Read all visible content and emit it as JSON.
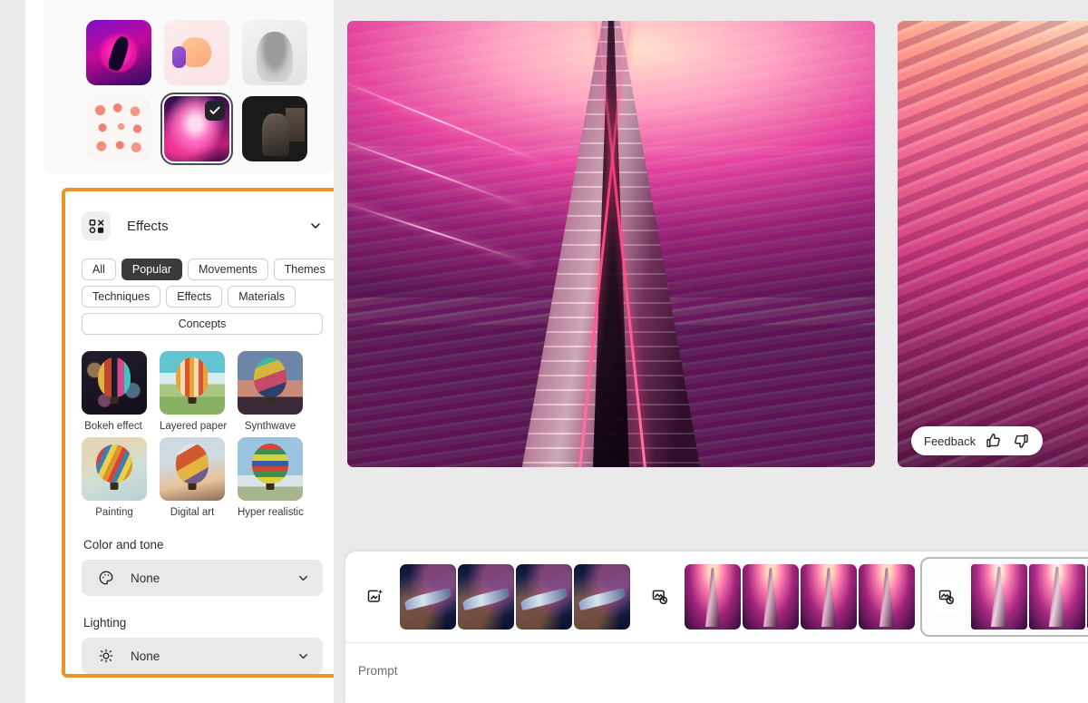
{
  "sidebar": {
    "style_grid": {
      "name": "style-presets",
      "items": [
        {
          "label": "Neon figure",
          "art": "t-neon",
          "selected": false
        },
        {
          "label": "3D thumbs up",
          "art": "t-thumb3d",
          "selected": false
        },
        {
          "label": "Pencil sketch portrait",
          "art": "t-sketch",
          "selected": false
        },
        {
          "label": "Hand poses sheet",
          "art": "t-hands",
          "selected": false
        },
        {
          "label": "Pink cloudscape",
          "art": "t-clouds",
          "selected": true
        },
        {
          "label": "Seated man photo",
          "art": "t-portrait",
          "selected": false
        }
      ]
    },
    "effects_panel": {
      "title": "Effects",
      "icon": "effects-grid-icon",
      "collapse_icon": "chevron-down-icon",
      "highlight_color": "#e8942a",
      "filters": [
        {
          "label": "All",
          "active": false
        },
        {
          "label": "Popular",
          "active": true
        },
        {
          "label": "Movements",
          "active": false
        },
        {
          "label": "Themes",
          "active": false
        },
        {
          "label": "Techniques",
          "active": false
        },
        {
          "label": "Effects",
          "active": false
        },
        {
          "label": "Materials",
          "active": false
        },
        {
          "label": "Concepts",
          "active": false
        }
      ],
      "effects": [
        {
          "label": "Bokeh effect",
          "art": "e-bokeh"
        },
        {
          "label": "Layered paper",
          "art": "e-layered"
        },
        {
          "label": "Synthwave",
          "art": "e-synth"
        },
        {
          "label": "Painting",
          "art": "e-paint"
        },
        {
          "label": "Digital art",
          "art": "e-digital"
        },
        {
          "label": "Hyper realistic",
          "art": "e-hyper"
        }
      ],
      "color_and_tone": {
        "title": "Color and tone",
        "value": "None",
        "icon": "palette-icon",
        "chevron": "chevron-down-icon"
      },
      "lighting": {
        "title": "Lighting",
        "value": "None",
        "icon": "brightness-icon",
        "chevron": "chevron-down-icon"
      }
    }
  },
  "canvas": {
    "main_image_alt": "Skyscraper seen from below against pink clouds",
    "side_image_alt": "Pink clouds seen from above",
    "feedback": {
      "label": "Feedback",
      "thumbs_up_icon": "thumbs-up-icon",
      "thumbs_down_icon": "thumbs-down-icon"
    }
  },
  "bottom_panel": {
    "batches": [
      {
        "icon": "generate-image-icon",
        "active": false,
        "frames": [
          {
            "alt": "Spaceship over planet 1",
            "art": "f-ship"
          },
          {
            "alt": "Spaceship over planet 2",
            "art": "f-ship"
          },
          {
            "alt": "Spaceship over planet 3",
            "art": "f-ship"
          },
          {
            "alt": "Spaceship over planet 4",
            "art": "f-ship"
          }
        ]
      },
      {
        "icon": "reference-image-icon",
        "active": false,
        "frames": [
          {
            "alt": "City tower 1",
            "art": "f-city"
          },
          {
            "alt": "City tower 2",
            "art": "f-city"
          },
          {
            "alt": "City tower 3",
            "art": "f-city"
          },
          {
            "alt": "City tower 4",
            "art": "f-city"
          }
        ]
      },
      {
        "icon": "reference-image-icon",
        "active": true,
        "frames": [
          {
            "alt": "Pink tower 1",
            "art": "f-pink"
          },
          {
            "alt": "Pink tower 2",
            "art": "f-pink"
          },
          {
            "alt": "Pink tower 3",
            "art": "f-pink"
          }
        ]
      }
    ],
    "prompt": {
      "placeholder": "Prompt",
      "value": ""
    }
  }
}
